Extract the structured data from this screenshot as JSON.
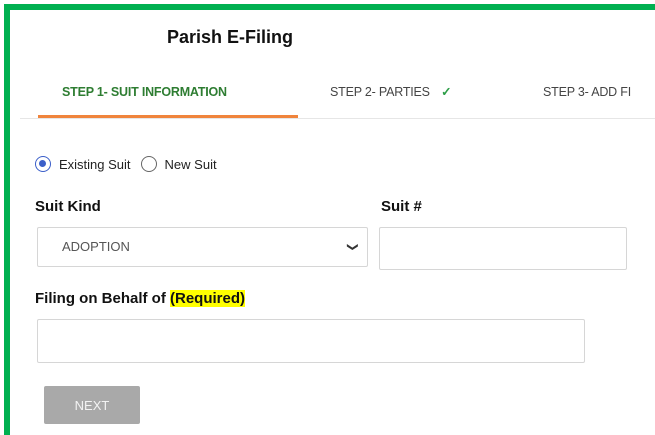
{
  "app": {
    "title": "Parish E-Filing"
  },
  "steps": [
    {
      "label": "STEP 1- SUIT INFORMATION"
    },
    {
      "label": "STEP 2- PARTIES",
      "check": "✓"
    },
    {
      "label": "STEP 3- ADD FI"
    }
  ],
  "suit_type": {
    "options": [
      {
        "label": "Existing Suit",
        "selected": true
      },
      {
        "label": "New Suit",
        "selected": false
      }
    ]
  },
  "form": {
    "suit_kind_label": "Suit Kind",
    "suit_kind_value": "ADOPTION",
    "suit_number_label": "Suit #",
    "suit_number_value": "",
    "behalf_label": "Filing on Behalf of",
    "behalf_required": "(Required)",
    "behalf_value": ""
  },
  "actions": {
    "next_label": "NEXT"
  },
  "colors": {
    "frame": "#00b050",
    "active_tab_underline": "#f0843c",
    "active_tab_text": "#2e7d32",
    "highlight": "#ffff00",
    "radio_selected": "#3b5fc9"
  }
}
